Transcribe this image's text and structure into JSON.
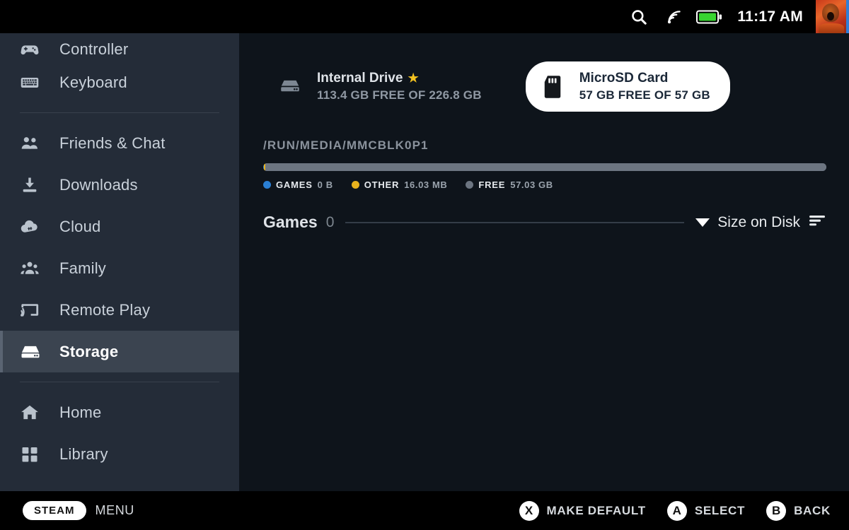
{
  "statusbar": {
    "search_icon": "search-icon",
    "wifi_icon": "wifi-icon",
    "battery_icon": "battery-icon",
    "time": "11:17 AM",
    "avatar": "user-avatar"
  },
  "sidebar": {
    "items": [
      {
        "label": "Controller",
        "icon": "gamepad-icon",
        "active": false
      },
      {
        "label": "Keyboard",
        "icon": "keyboard-icon",
        "active": false
      },
      {
        "label": "Friends & Chat",
        "icon": "friends-icon",
        "active": false
      },
      {
        "label": "Downloads",
        "icon": "download-icon",
        "active": false
      },
      {
        "label": "Cloud",
        "icon": "cloud-icon",
        "active": false
      },
      {
        "label": "Family",
        "icon": "family-icon",
        "active": false
      },
      {
        "label": "Remote Play",
        "icon": "remote-play-icon",
        "active": false
      },
      {
        "label": "Storage",
        "icon": "storage-icon",
        "active": true
      },
      {
        "label": "Home",
        "icon": "home-icon",
        "active": false
      },
      {
        "label": "Library",
        "icon": "library-icon",
        "active": false
      }
    ]
  },
  "drives": [
    {
      "name": "Internal Drive",
      "capacity_line": "113.4 GB FREE OF 226.8 GB",
      "is_default": true,
      "default_marker": "★",
      "selected": false,
      "icon": "internal-drive-icon"
    },
    {
      "name": "MicroSD Card",
      "capacity_line": "57 GB FREE OF 57 GB",
      "is_default": false,
      "selected": true,
      "icon": "microsd-card-icon"
    }
  ],
  "storage": {
    "mount_path": "/RUN/MEDIA/MMCBLK0P1",
    "legend": [
      {
        "key": "GAMES",
        "value": "0 B",
        "color": "#2a7fd4",
        "percent": 0
      },
      {
        "key": "OTHER",
        "value": "16.03 MB",
        "color": "#e8b21d",
        "percent": 0.03
      },
      {
        "key": "FREE",
        "value": "57.03 GB",
        "color": "#6c7581",
        "percent": 99.97
      }
    ]
  },
  "games_section": {
    "title": "Games",
    "count": "0",
    "sort_label": "Size on Disk",
    "sort_caret_icon": "chevron-down-icon",
    "sort_list_icon": "sort-icon"
  },
  "bottombar": {
    "steam_pill": "STEAM",
    "menu_label": "MENU",
    "hints": [
      {
        "button": "X",
        "label": "MAKE DEFAULT"
      },
      {
        "button": "A",
        "label": "SELECT"
      },
      {
        "button": "B",
        "label": "BACK"
      }
    ]
  },
  "colors": {
    "accent_blue": "#2a7fd4",
    "accent_yellow": "#e8b21d",
    "neutral_gray": "#6c7581",
    "sidebar_bg": "#242c38",
    "main_bg": "#0e141b",
    "selected_row": "#3b4450",
    "battery_green": "#38d430"
  }
}
